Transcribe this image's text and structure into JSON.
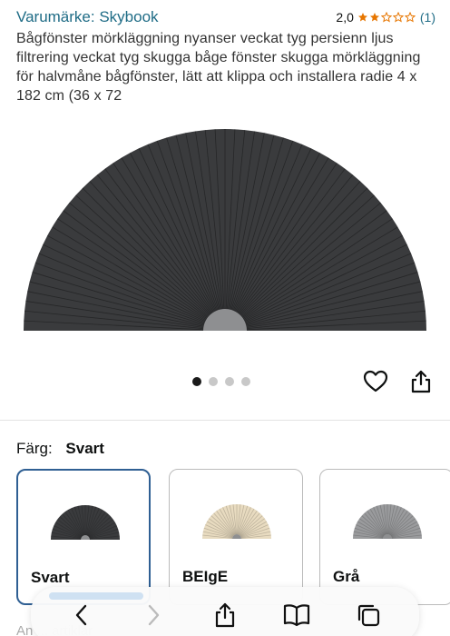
{
  "header": {
    "brand_link": "Varumärke: Skybook",
    "rating_value": "2,0",
    "rating_stars": 2,
    "rating_count": "(1)"
  },
  "product": {
    "title": "Bågfönster mörkläggning nyanser veckat tyg persienn ljus filtrering veckat tyg skugga båge fönster skugga mörkläggning för halvmåne bågfönster, lätt att klippa och installera radie 4 x 182 cm (36 x 72"
  },
  "gallery": {
    "image_count": 4,
    "active_index": 0
  },
  "variants": {
    "label": "Färg:",
    "selected": "Svart",
    "options": [
      {
        "name": "Svart",
        "color": "#3a3b3d"
      },
      {
        "name": "BEIgE",
        "color": "#e8dbc0"
      },
      {
        "name": "Grå",
        "color": "#9a9b9d"
      }
    ]
  },
  "peek": {
    "text": "An ... artiklar"
  },
  "colors": {
    "link": "#1f6c86",
    "star": "#e77600",
    "selected_border": "#2f5f93"
  }
}
